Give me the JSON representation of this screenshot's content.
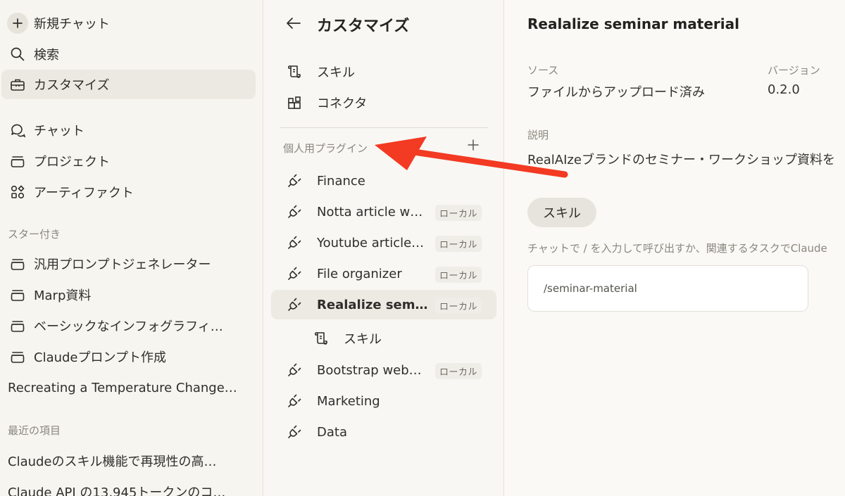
{
  "sidebar": {
    "new_chat": "新規チャット",
    "search": "検索",
    "customize": "カスタマイズ",
    "chats": "チャット",
    "projects": "プロジェクト",
    "artifacts": "アーティファクト",
    "starred_header": "スター付き",
    "starred": [
      "汎用プロンプトジェネレーター",
      "Marp資料",
      "ベーシックなインフォグラフィ…",
      "Claudeプロンプト作成",
      "Recreating a Temperature Change…"
    ],
    "recent_header": "最近の項目",
    "recent": [
      "Claudeのスキル機能で再現性の高…",
      "Claude API の13,945トークンのコ…"
    ]
  },
  "customize": {
    "title": "カスタマイズ",
    "skills": "スキル",
    "connectors": "コネクタ",
    "plugins_header": "個人用プラグイン",
    "plugins": [
      {
        "name": "Finance",
        "badge": ""
      },
      {
        "name": "Notta article w…",
        "badge": "ローカル"
      },
      {
        "name": "Youtube article…",
        "badge": "ローカル"
      },
      {
        "name": "File organizer",
        "badge": "ローカル"
      },
      {
        "name": "Realalize semi…",
        "badge": "ローカル",
        "selected": true
      },
      {
        "name": "Bootstrap web…",
        "badge": "ローカル"
      },
      {
        "name": "Marketing",
        "badge": ""
      },
      {
        "name": "Data",
        "badge": ""
      }
    ],
    "selected_sub_item": "スキル"
  },
  "detail": {
    "title": "Realalize seminar material",
    "source_label": "ソース",
    "source_value": "ファイルからアップロード済み",
    "version_label": "バージョン",
    "version_value": "0.2.0",
    "description_label": "説明",
    "description_value": "RealAIzeブランドのセミナー・ワークショップ資料を",
    "skill_pill": "スキル",
    "hint": "チャットで / を入力して呼び出すか、関連するタスクでClaude",
    "command": "/seminar-material"
  },
  "colors": {
    "background": "#faf9f5",
    "sidebar": "#f6f5f0",
    "active_item": "#ebe9e1",
    "annotation_arrow": "#f33a22"
  }
}
